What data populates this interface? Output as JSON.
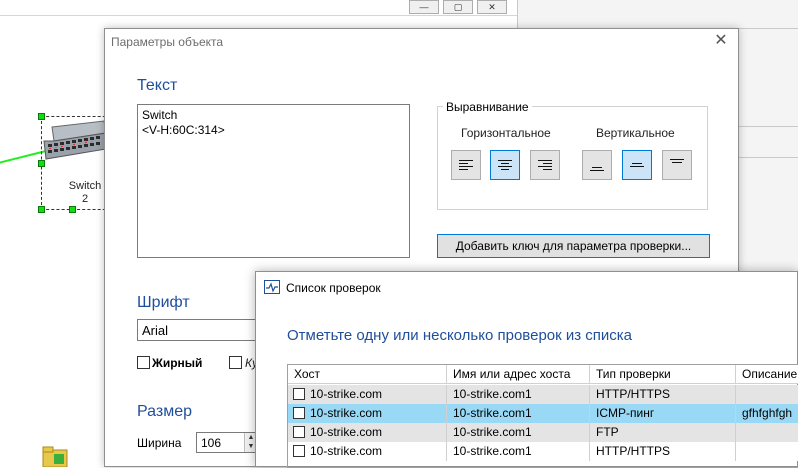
{
  "background_window": {
    "controls": [
      "—",
      "▢",
      "✕"
    ],
    "node": {
      "label_line1": "Switch",
      "label_line2": "2"
    }
  },
  "object_dialog": {
    "title": "Параметры объекта",
    "close": "✕",
    "text_section": "Текст",
    "text_value": "Switch\n<V-H:60C:314>",
    "alignment": {
      "legend": "Выравнивание",
      "horizontal_label": "Горизонтальное",
      "vertical_label": "Вертикальное",
      "horizontal_selected": "center",
      "vertical_selected": "middle"
    },
    "add_key_button": "Добавить ключ для параметра проверки...",
    "font_section": "Шрифт",
    "font_value": "Arial",
    "bold_label": "Жирный",
    "italic_label": "Ку",
    "size_section": "Размер",
    "width_label": "Ширина",
    "width_value": "106"
  },
  "checks_dialog": {
    "title": "Список проверок",
    "heading": "Отметьте одну или несколько проверок из списка",
    "columns": [
      "Хост",
      "Имя или адрес хоста",
      "Тип проверки",
      "Описание"
    ],
    "rows": [
      {
        "host": "10-strike.com",
        "address": "10-strike.com1",
        "type": "HTTP/HTTPS",
        "description": "",
        "checked": false
      },
      {
        "host": "10-strike.com",
        "address": "10-strike.com1",
        "type": "ICMP-пинг",
        "description": "gfhfghfgh",
        "checked": false
      },
      {
        "host": "10-strike.com",
        "address": "10-strike.com1",
        "type": "FTP",
        "description": "",
        "checked": false
      },
      {
        "host": "10-strike.com",
        "address": "10-strike.com1",
        "type": "HTTP/HTTPS",
        "description": "",
        "checked": false
      }
    ]
  }
}
